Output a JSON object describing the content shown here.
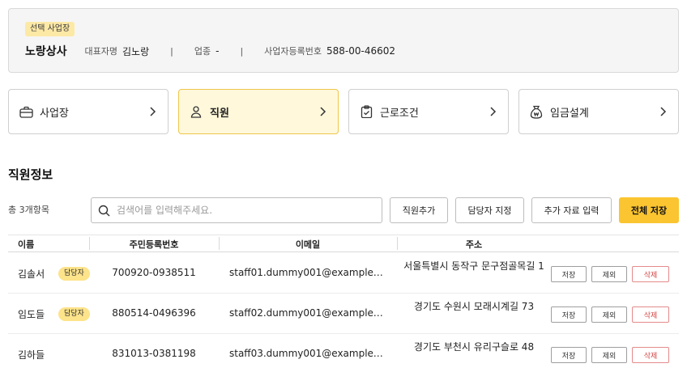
{
  "company": {
    "badge": "선택 사업장",
    "name": "노랑상사",
    "rep_label": "대표자명",
    "rep_value": "김노랑",
    "sep": "|",
    "industry_label": "업종",
    "industry_value": "-",
    "bizno_label": "사업자등록번호",
    "bizno_value": "588-00-46602"
  },
  "nav": [
    {
      "label": "사업장",
      "icon": "briefcase-icon"
    },
    {
      "label": "직원",
      "icon": "person-icon",
      "active": true
    },
    {
      "label": "근로조건",
      "icon": "clipboard-check-icon"
    },
    {
      "label": "임금설계",
      "icon": "money-bag-icon"
    }
  ],
  "section": {
    "title": "직원정보",
    "count": "총 3개항목"
  },
  "search": {
    "placeholder": "검색어를 입력해주세요.",
    "value": ""
  },
  "toolbar": {
    "add_employee": "직원추가",
    "assign_manager": "담당자 지정",
    "extra_input": "추가 자료 입력",
    "save_all": "전체 저장"
  },
  "table": {
    "headers": [
      "이름",
      "주민등록번호",
      "이메일",
      "주소"
    ],
    "rows": [
      {
        "name": "김솔서",
        "badge": "담당자",
        "rrn": "700920-0938511",
        "email": "staff01.dummy001@example.…",
        "address": "서울특별시 동작구 문구점골목길 1"
      },
      {
        "name": "임도들",
        "badge": "담당자",
        "rrn": "880514-0496396",
        "email": "staff02.dummy001@example.…",
        "address": "경기도 수원시 모래시계길 73"
      },
      {
        "name": "김하들",
        "badge": "",
        "rrn": "831013-0381198",
        "email": "staff03.dummy001@example.…",
        "address": "경기도 부천시 유리구슬로 48"
      }
    ],
    "row_actions": {
      "save": "저장",
      "exclude": "제외",
      "delete": "삭제"
    }
  },
  "colors": {
    "accent": "#fbc531",
    "active_nav_bg": "#fff8db",
    "badge_bg": "#fde38a",
    "delete_red": "#d64545"
  }
}
